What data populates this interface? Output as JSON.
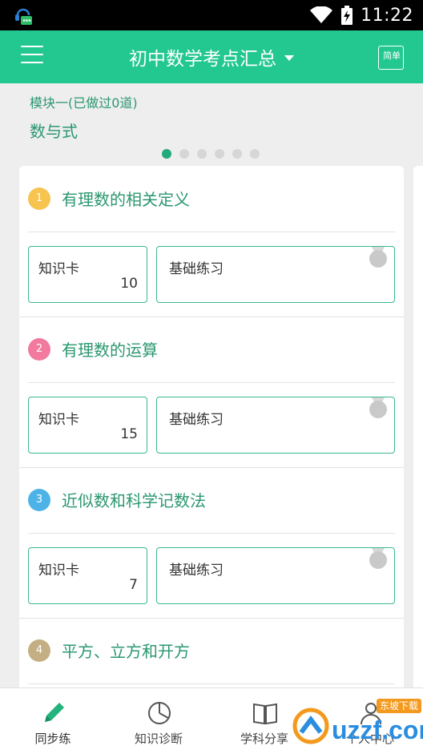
{
  "status_bar": {
    "time": "11:22"
  },
  "header": {
    "title": "初中数学考点汇总",
    "mode_label": "简单"
  },
  "module": {
    "subtitle": "模块一(已做过0道)",
    "title": "数与式",
    "page_count": 6,
    "active_page": 1
  },
  "sections": [
    {
      "number": "1",
      "title": "有理数的相关定义",
      "badge_color": "#f6c44f",
      "knowledge_label": "知识卡",
      "knowledge_count": "10",
      "practice_label": "基础练习"
    },
    {
      "number": "2",
      "title": "有理数的运算",
      "badge_color": "#f27a9e",
      "knowledge_label": "知识卡",
      "knowledge_count": "15",
      "practice_label": "基础练习"
    },
    {
      "number": "3",
      "title": "近似数和科学记数法",
      "badge_color": "#4db3e6",
      "knowledge_label": "知识卡",
      "knowledge_count": "7",
      "practice_label": "基础练习"
    },
    {
      "number": "4",
      "title": "平方、立方和开方",
      "badge_color": "#c4ae83"
    }
  ],
  "bottom_nav": [
    {
      "label": "同步练",
      "icon": "pencil-icon",
      "active": true,
      "color": "#22b47c"
    },
    {
      "label": "知识诊断",
      "icon": "pie-chart-icon",
      "active": false
    },
    {
      "label": "学科分享",
      "icon": "book-icon",
      "active": false
    },
    {
      "label": "个人中心",
      "icon": "person-icon",
      "active": false
    }
  ],
  "watermark": {
    "text": "uzzf.com",
    "tag": "东坡下载"
  },
  "colors": {
    "primary": "#22c88f",
    "accent_text": "#2b9770",
    "card_border": "#3ab98c"
  }
}
